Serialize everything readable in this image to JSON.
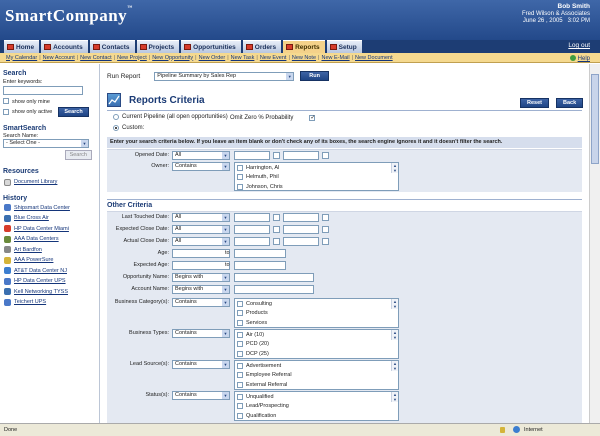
{
  "header": {
    "logo_main": "SmartCompany",
    "user_name": "Bob Smith",
    "user_company": "Fred Wilson & Associates",
    "user_date": "June 26 , 2005",
    "user_time": "3:02 PM",
    "logout": "Log out"
  },
  "tabs": [
    "Home",
    "Accounts",
    "Contacts",
    "Projects",
    "Opportunities",
    "Orders",
    "Reports",
    "Setup"
  ],
  "active_tab": "Reports",
  "subnav": [
    "My Calendar",
    "New Account",
    "New Contact",
    "New Project",
    "New Opportunity",
    "New Order",
    "New Task",
    "New Event",
    "New Note",
    "New E-Mail",
    "New Document"
  ],
  "help": "Help",
  "sidebar": {
    "search_title": "Search",
    "keywords_label": "Enter keywords:",
    "keywords_value": "",
    "show_mine": "show only mine",
    "show_active": "show only active",
    "search_btn": "Search",
    "smartsearch_title": "SmartSearch",
    "search_name_label": "Search Name:",
    "select_one": "- Select One -",
    "search_btn2": "Search",
    "resources_title": "Resources",
    "doc_library": "Document Library",
    "history_title": "History",
    "history": [
      "Shipsmart Data Center",
      "Blue Cross Air",
      "HP Data Center Miami",
      "AAA Data Centers",
      "Art Bardfon",
      "AAA PowerSure",
      "AT&T Data Center NJ",
      "HP Data Center UPS",
      "Kell Networking TYSS",
      "Teichert UPS"
    ]
  },
  "main": {
    "run_report_label": "Run Report",
    "report_select": "Pipeline Summary by Sales Rep",
    "run_btn": "Run",
    "title": "Reports Criteria",
    "reset_btn": "Reset",
    "back_btn": "Back",
    "radio_current": "Current Pipeline (all open opportunities)",
    "radio_custom": "Custom:",
    "omit_zero": "Omit Zero % Probability",
    "instructions": "Enter your search criteria below. If you leave an item blank or don't check any of its boxes, the search engine ignores it and it doesn't filter the search.",
    "opened_date": "Opened Date:",
    "owner": "Owner:",
    "all": "All",
    "contains": "Contains",
    "owners": [
      "Harrington, Al",
      "Helmuth, Phil",
      "Johnson, Chris"
    ],
    "other_criteria": "Other Criteria",
    "last_touched": "Last Touched Date:",
    "expected_close": "Expected Close Date:",
    "actual_close": "Actual Close Date:",
    "age": "Age:",
    "expected_age": "Expected Age:",
    "to": "to",
    "opp_name": "Opportunity Name:",
    "acct_name": "Account Name:",
    "begins_with": "Begins with",
    "biz_cat": "Business Category(s):",
    "biz_cats": [
      "Consulting",
      "Products",
      "Services"
    ],
    "biz_types": "Business Types:",
    "types": [
      "Air (10)",
      "PCD (20)",
      "DCP (25)"
    ],
    "lead_src": "Lead Source(s):",
    "leads": [
      "Advertisement",
      "Employee Referral",
      "External Referral"
    ],
    "status": "Status(s):",
    "statuses": [
      "Unqualified",
      "Lead/Prospecting",
      "Qualification"
    ]
  },
  "status_bar": {
    "left": "Done",
    "zone": "Internet"
  },
  "colors": {
    "header": "#23498a",
    "tab_active": "#f4d28a",
    "subnav": "#f5d98f",
    "accent_red": "#d73c2b"
  }
}
